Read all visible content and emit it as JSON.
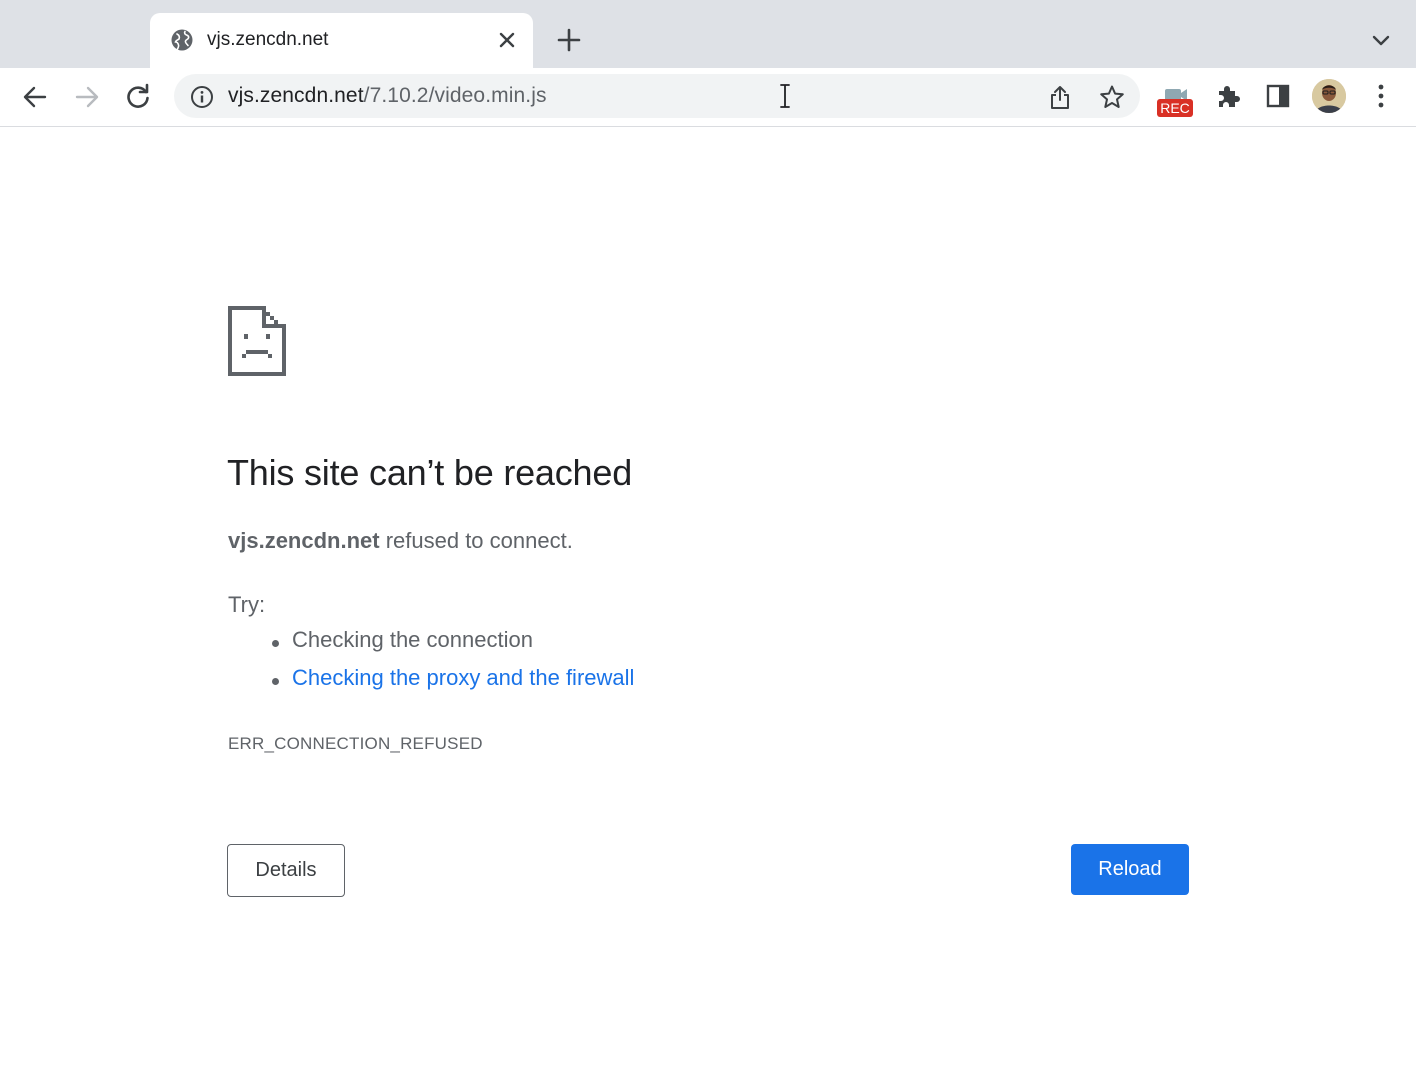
{
  "browser": {
    "tab": {
      "title": "vjs.zencdn.net",
      "favicon": "globe-icon"
    },
    "omnibox": {
      "url_host": "vjs.zencdn.net",
      "url_path": "/7.10.2/video.min.js"
    },
    "extension_badge": "REC",
    "icons": {
      "back": "arrow-left-icon",
      "forward": "arrow-right-icon",
      "reload": "reload-icon",
      "info": "info-icon",
      "share": "share-icon",
      "bookmark": "star-icon",
      "extensions": "puzzle-icon",
      "side_panel": "side-panel-icon",
      "menu": "kebab-menu-icon"
    }
  },
  "error_page": {
    "heading": "This site can’t be reached",
    "host": "vjs.zencdn.net",
    "message": " refused to connect.",
    "try_label": "Try:",
    "suggestions": [
      "Checking the connection",
      "Checking the proxy and the firewall"
    ],
    "error_code": "ERR_CONNECTION_REFUSED",
    "details_button": "Details",
    "reload_button": "Reload"
  },
  "colors": {
    "accent": "#1a73e8",
    "text": "#202124",
    "secondary_text": "#5f6368",
    "tabstrip": "#dee1e6",
    "rec_badge": "#d93025"
  }
}
